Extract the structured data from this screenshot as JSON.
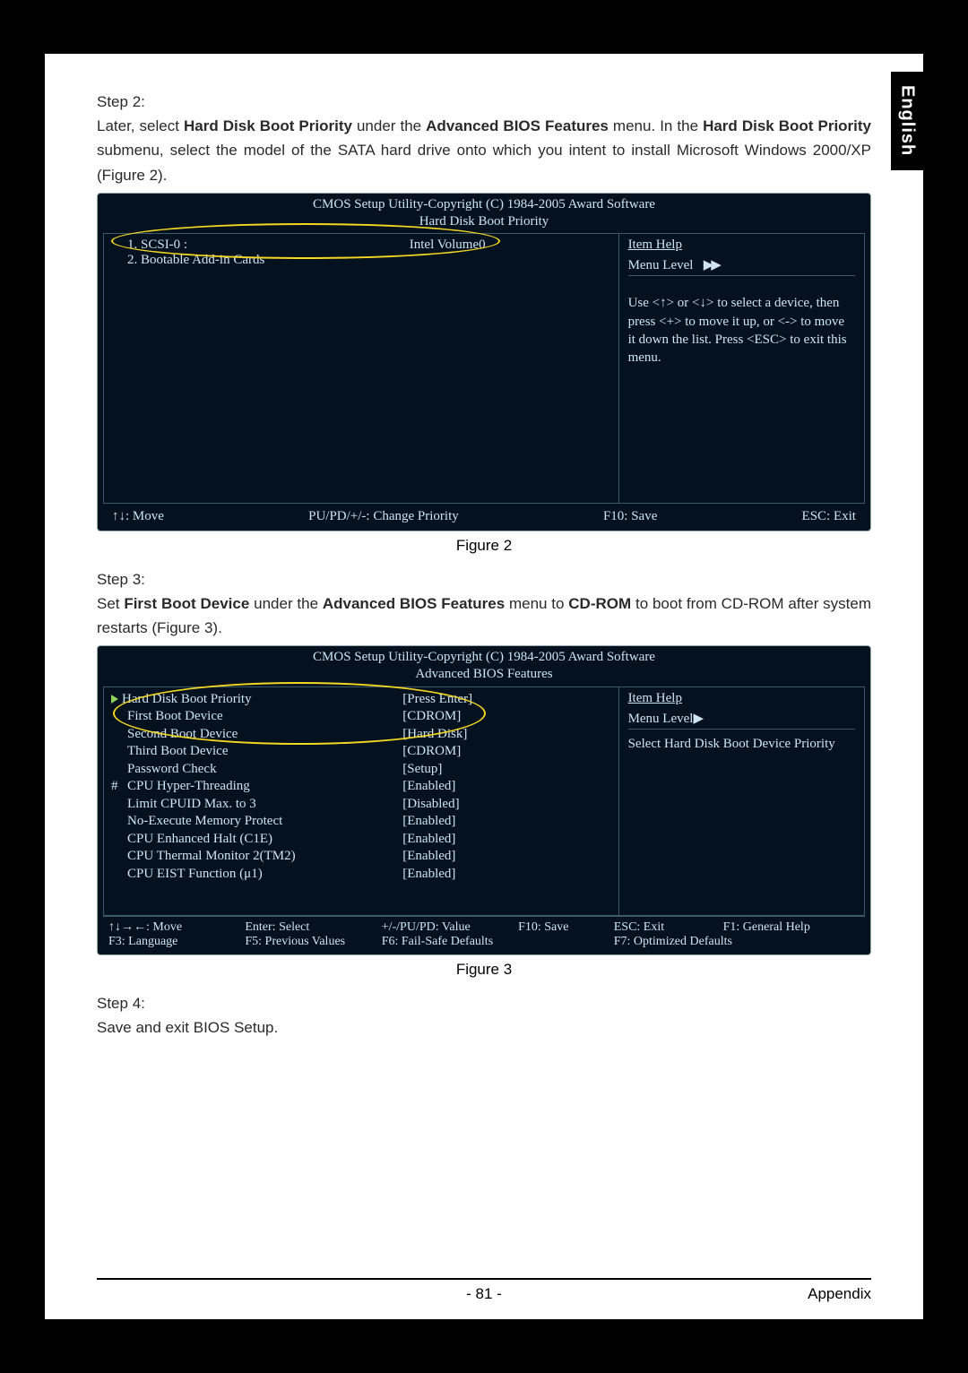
{
  "langTab": "English",
  "step2": {
    "heading": "Step 2:",
    "line_pre": "Later, select ",
    "b1": "Hard Disk Boot Priority",
    "mid1": " under the ",
    "b2": "Advanced BIOS Features",
    "mid2": " menu. In the ",
    "b3": "Hard Disk Boot Priority",
    "mid3": " submenu, select the model of the SATA hard drive onto which you intent to install Microsoft Windows 2000/XP (Figure 2)."
  },
  "fig2": {
    "title1": "CMOS Setup Utility-Copyright (C) 1984-2005 Award Software",
    "title2": "Hard Disk Boot Priority",
    "row1_left": "1. SCSI-0    :",
    "row1_right": "Intel Volume0",
    "row2": "2. Bootable Add-in Cards",
    "help_title": "Item Help",
    "menu_level": "Menu Level",
    "menu_arrows": "▶▶",
    "help_text": "Use <↑> or <↓> to select a device, then press <+> to move it up, or <-> to move it down the list. Press <ESC> to exit this menu.",
    "footer": {
      "move": "↑↓: Move",
      "change": "PU/PD/+/-: Change Priority",
      "save": "F10: Save",
      "exit": "ESC: Exit"
    },
    "caption": "Figure 2"
  },
  "step3": {
    "heading": "Step 3:",
    "pre": "Set ",
    "b1": "First Boot Device",
    "mid1": " under the ",
    "b2": "Advanced BIOS Features",
    "mid2": " menu to ",
    "b3": "CD-ROM",
    "post": " to boot from CD-ROM after system restarts (Figure 3)."
  },
  "fig3": {
    "title1": "CMOS Setup Utility-Copyright (C) 1984-2005 Award Software",
    "title2": "Advanced BIOS Features",
    "items": [
      {
        "marker": "tri",
        "label": "Hard Disk Boot Priority",
        "value": "[Press Enter]"
      },
      {
        "marker": "",
        "label": "First Boot Device",
        "value": "[CDROM]"
      },
      {
        "marker": "",
        "label": "Second Boot Device",
        "value": "[Hard Disk]"
      },
      {
        "marker": "",
        "label": "Third Boot Device",
        "value": "[CDROM]"
      },
      {
        "marker": "",
        "label": "Password Check",
        "value": "[Setup]"
      },
      {
        "marker": "#",
        "label": "CPU Hyper-Threading",
        "value": "[Enabled]"
      },
      {
        "marker": "",
        "label": "Limit CPUID Max. to 3",
        "value": "[Disabled]"
      },
      {
        "marker": "",
        "label": "No-Execute Memory Protect",
        "value": "[Enabled]"
      },
      {
        "marker": "",
        "label": "CPU Enhanced Halt (C1E)",
        "value": "[Enabled]"
      },
      {
        "marker": "",
        "label": "CPU Thermal Monitor 2(TM2)",
        "value": "[Enabled]"
      },
      {
        "marker": "",
        "label": "CPU EIST Function (μ1)",
        "value": "[Enabled]"
      }
    ],
    "help_title": "Item Help",
    "menu_level": "Menu Level",
    "menu_arrow": "▶",
    "help_text": "Select Hard Disk Boot Device Priority",
    "footer_row1": {
      "c1": "↑↓→←: Move",
      "c2": "Enter: Select",
      "c3": "+/-/PU/PD: Value",
      "c4": "F10: Save",
      "c5": "ESC: Exit",
      "c6": "F1: General Help"
    },
    "footer_row2": {
      "c1": "F3: Language",
      "c2": "F5: Previous Values",
      "c3": "F6: Fail-Safe Defaults",
      "c4": "",
      "c5": "F7: Optimized Defaults",
      "c6": ""
    },
    "caption": "Figure 3"
  },
  "step4": {
    "heading": "Step 4:",
    "text": "Save and exit BIOS Setup."
  },
  "footer": {
    "page": "- 81 -",
    "section": "Appendix"
  }
}
